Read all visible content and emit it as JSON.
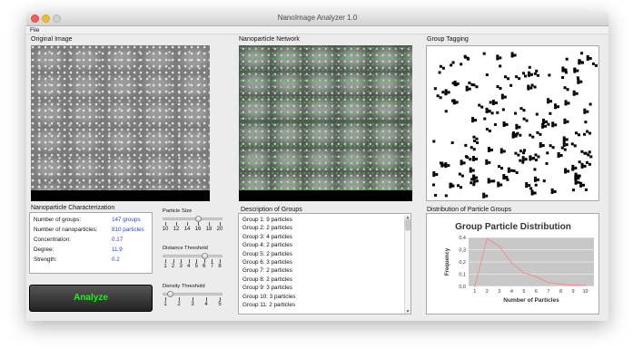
{
  "window": {
    "title": "NanoImage Analyzer 1.0"
  },
  "menu": {
    "file": "File"
  },
  "panels": {
    "original": "Original Image",
    "network": "Nanoparticle Network",
    "tagging": "Group Tagging",
    "characterization": "Nanoparticle Characterization",
    "description": "Description of Groups",
    "distribution": "Distribution of Particle Groups"
  },
  "stats": [
    {
      "label": "Number of groups:",
      "value": "147 groups"
    },
    {
      "label": "Number of nanoparticles:",
      "value": "810 particles"
    },
    {
      "label": "Concentration:",
      "value": "0.17"
    },
    {
      "label": "Degree:",
      "value": "11.9"
    },
    {
      "label": "Strength:",
      "value": "0.2"
    }
  ],
  "sliders": [
    {
      "title": "Particle Size",
      "ticks": [
        "10",
        "12",
        "14",
        "16",
        "18",
        "20"
      ],
      "value": 16,
      "min": 10,
      "max": 20
    },
    {
      "title": "Distance Threshold",
      "ticks": [
        "1",
        "2",
        "3",
        "4",
        "5",
        "6",
        "7",
        "8"
      ],
      "value": 6,
      "min": 1,
      "max": 8
    },
    {
      "title": "Density Threshold",
      "ticks": [
        "1",
        "2",
        "3",
        "4",
        "5"
      ],
      "value": 1.4,
      "min": 1,
      "max": 5
    }
  ],
  "analyze_button": "Analyze",
  "groups": [
    "Group 1: 9 particles",
    "Group 2: 2 particles",
    "Group 3: 4 particles",
    "Group 4: 2 particles",
    "Group 5: 2 particles",
    "Group 6: 3 particles",
    "Group 7: 2 particles",
    "Group 8: 2 particles",
    "Group 9: 3 particles",
    "Group 10: 3 particles",
    "Group 11: 2 particles"
  ],
  "chart_data": {
    "type": "line",
    "title": "Group Particle Distribution",
    "xlabel": "Number of Particles",
    "ylabel": "Frequency",
    "x": [
      1,
      2,
      3,
      4,
      5,
      6,
      7,
      8,
      9,
      10
    ],
    "y_ticks": [
      "0,0",
      "0,1",
      "0,2",
      "0,3",
      "0,4"
    ],
    "x_ticks": [
      "1",
      "2",
      "3",
      "4",
      "5",
      "6",
      "7",
      "8",
      "9",
      "10"
    ],
    "series": [
      {
        "values": [
          0.0,
          0.39,
          0.33,
          0.19,
          0.11,
          0.08,
          0.03,
          0.02,
          0.01,
          0.01
        ],
        "color": "#f08a8a"
      }
    ],
    "ylim": [
      0,
      0.4
    ],
    "xlim": [
      0.5,
      10.7
    ],
    "plot_background": "#c8c8c8",
    "grid": true
  }
}
